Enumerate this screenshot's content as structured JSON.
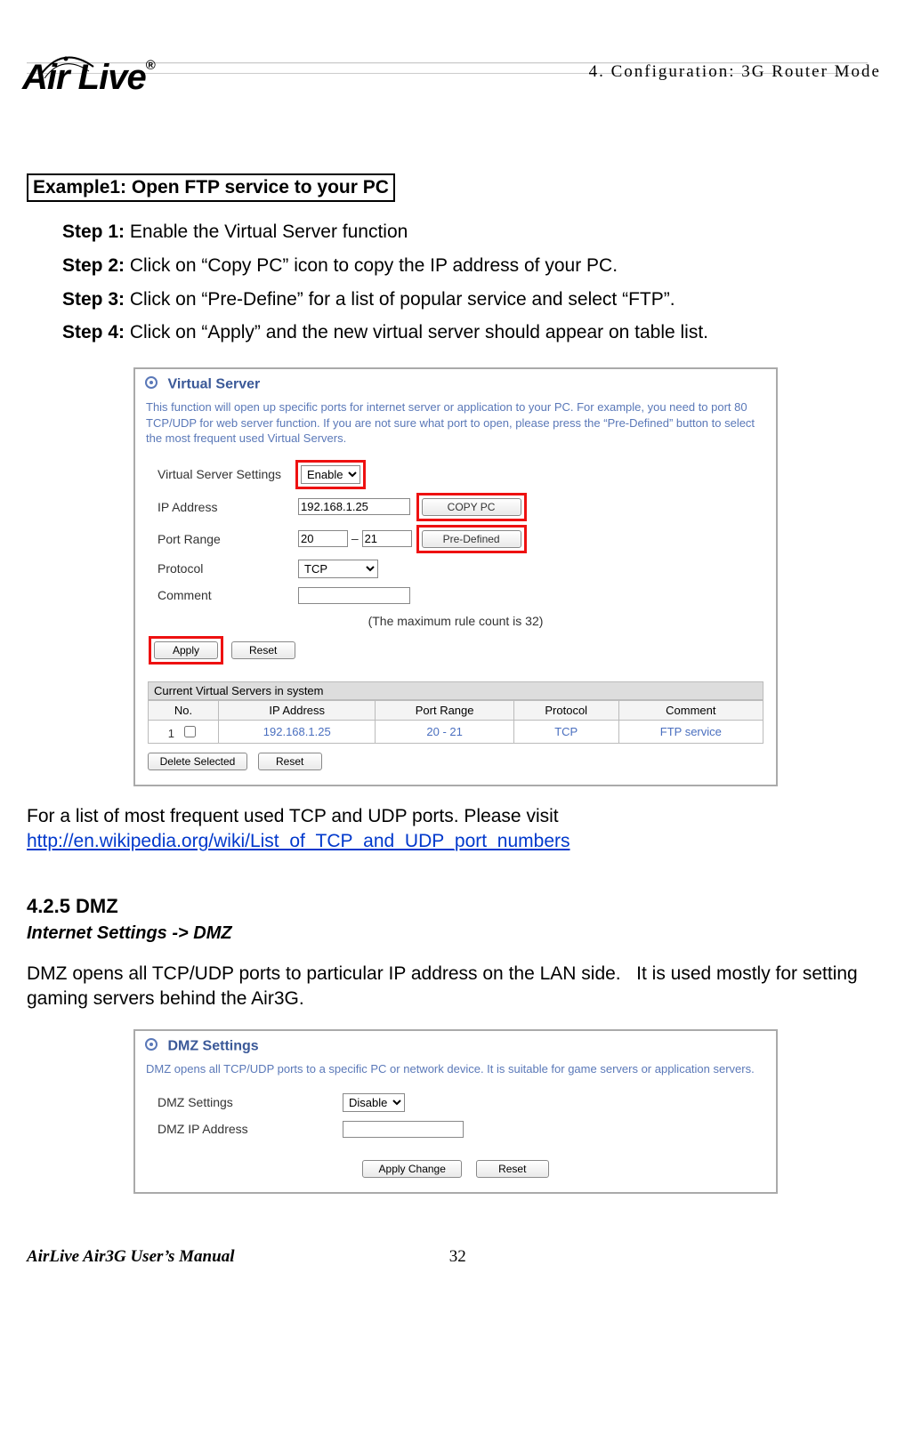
{
  "chapter": "4. Configuration: 3G Router Mode",
  "logo_text": "Air Live",
  "example_title": "Example1: Open FTP service to your PC",
  "steps": [
    {
      "label": "Step 1:",
      "text": " Enable the Virtual Server function"
    },
    {
      "label": "Step 2:",
      "text": " Click on “Copy PC” icon to copy the IP address of your PC."
    },
    {
      "label": "Step 3:",
      "text": " Click on “Pre-Define” for a list of popular service and select “FTP”."
    },
    {
      "label": "Step 4:",
      "text": " Click on “Apply” and the new virtual server should appear on table list."
    }
  ],
  "vs": {
    "panel_title": "Virtual Server",
    "panel_desc": "This function will open up specific ports for internet server or application to your PC. For example, you need to port 80 TCP/UDP for web server function. If you are not sure what port to open, please press the “Pre-Defined” button to select the most frequent used Virtual Servers.",
    "labels": {
      "settings": "Virtual Server Settings",
      "ip": "IP Address",
      "port": "Port Range",
      "proto": "Protocol",
      "comment": "Comment"
    },
    "values": {
      "settings": "Enable",
      "ip": "192.168.1.25",
      "port_from": "20",
      "port_to": "21",
      "proto": "TCP",
      "comment": ""
    },
    "buttons": {
      "copypc": "COPY PC",
      "predef": "Pre-Defined",
      "apply": "Apply",
      "reset": "Reset",
      "delsel": "Delete Selected",
      "reset2": "Reset"
    },
    "maxnote": "(The maximum rule count is 32)",
    "list_title": "Current Virtual Servers in system",
    "columns": {
      "no": "No.",
      "ip": "IP Address",
      "pr": "Port Range",
      "proto": "Protocol",
      "comment": "Comment"
    },
    "row": {
      "no": "1",
      "ip": "192.168.1.25",
      "pr": "20 - 21",
      "proto": "TCP",
      "comment": "FTP service"
    }
  },
  "ports_text": "For a list of most frequent used TCP and UDP ports. Please visit",
  "ports_link": "http://en.wikipedia.org/wiki/List_of_TCP_and_UDP_port_numbers",
  "dmz": {
    "heading": "4.2.5 DMZ",
    "sub": "Internet Settings -> DMZ",
    "para": "DMZ opens all TCP/UDP ports to particular IP address on the LAN side.   It is used mostly for setting gaming servers behind the Air3G.",
    "panel_title": "DMZ Settings",
    "panel_desc": "DMZ opens all TCP/UDP ports to a specific PC or network device. It is suitable for game servers or application servers.",
    "labels": {
      "settings": "DMZ Settings",
      "ip": "DMZ IP Address"
    },
    "values": {
      "settings": "Disable",
      "ip": ""
    },
    "buttons": {
      "apply": "Apply Change",
      "reset": "Reset"
    }
  },
  "footer": {
    "manual": "AirLive Air3G User’s Manual",
    "page": "32"
  }
}
